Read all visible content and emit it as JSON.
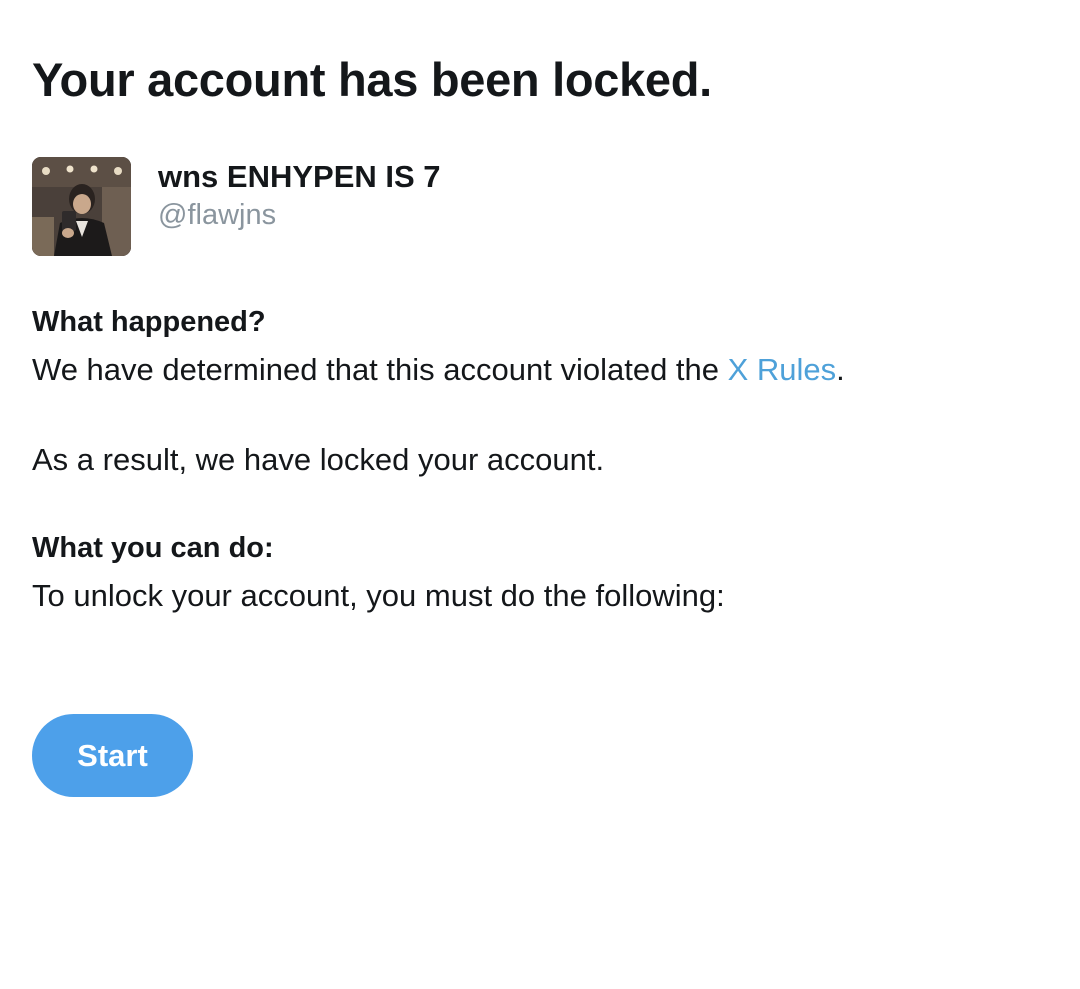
{
  "page": {
    "title": "Your account has been locked."
  },
  "profile": {
    "display_name": "wns ENHYPEN IS 7",
    "handle": "@flawjns",
    "avatar_icon": "user-photo"
  },
  "what_happened": {
    "heading": "What happened?",
    "text_before_link": "We have determined that this account violated the ",
    "link_text": "X Rules",
    "text_after_link": ".",
    "result_text": "As a result, we have locked your account."
  },
  "what_you_can_do": {
    "heading": "What you can do:",
    "text": "To unlock your account, you must do the following:"
  },
  "actions": {
    "start_label": "Start"
  },
  "colors": {
    "text": "#14171a",
    "secondary_text": "#8a959e",
    "link": "#4ea1d9",
    "button_bg": "#4da0ea",
    "button_text": "#ffffff",
    "background": "#ffffff"
  }
}
